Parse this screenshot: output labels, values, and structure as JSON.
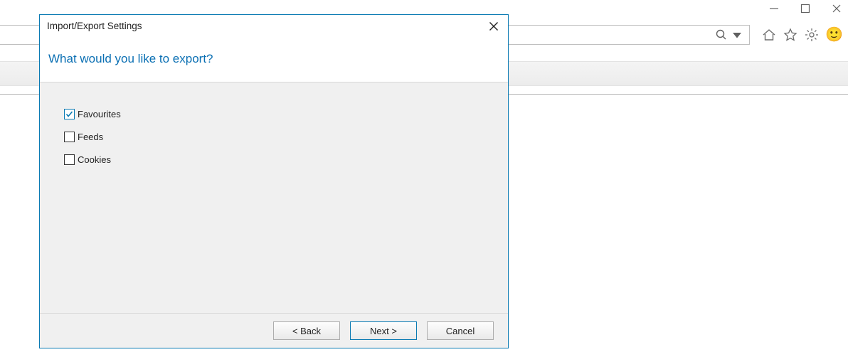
{
  "dialog": {
    "title": "Import/Export Settings",
    "heading": "What would you like to export?",
    "options": {
      "favourites": {
        "label": "Favourites",
        "checked": true
      },
      "feeds": {
        "label": "Feeds",
        "checked": false
      },
      "cookies": {
        "label": "Cookies",
        "checked": false
      }
    },
    "buttons": {
      "back": "< Back",
      "next": "Next >",
      "cancel": "Cancel"
    }
  }
}
